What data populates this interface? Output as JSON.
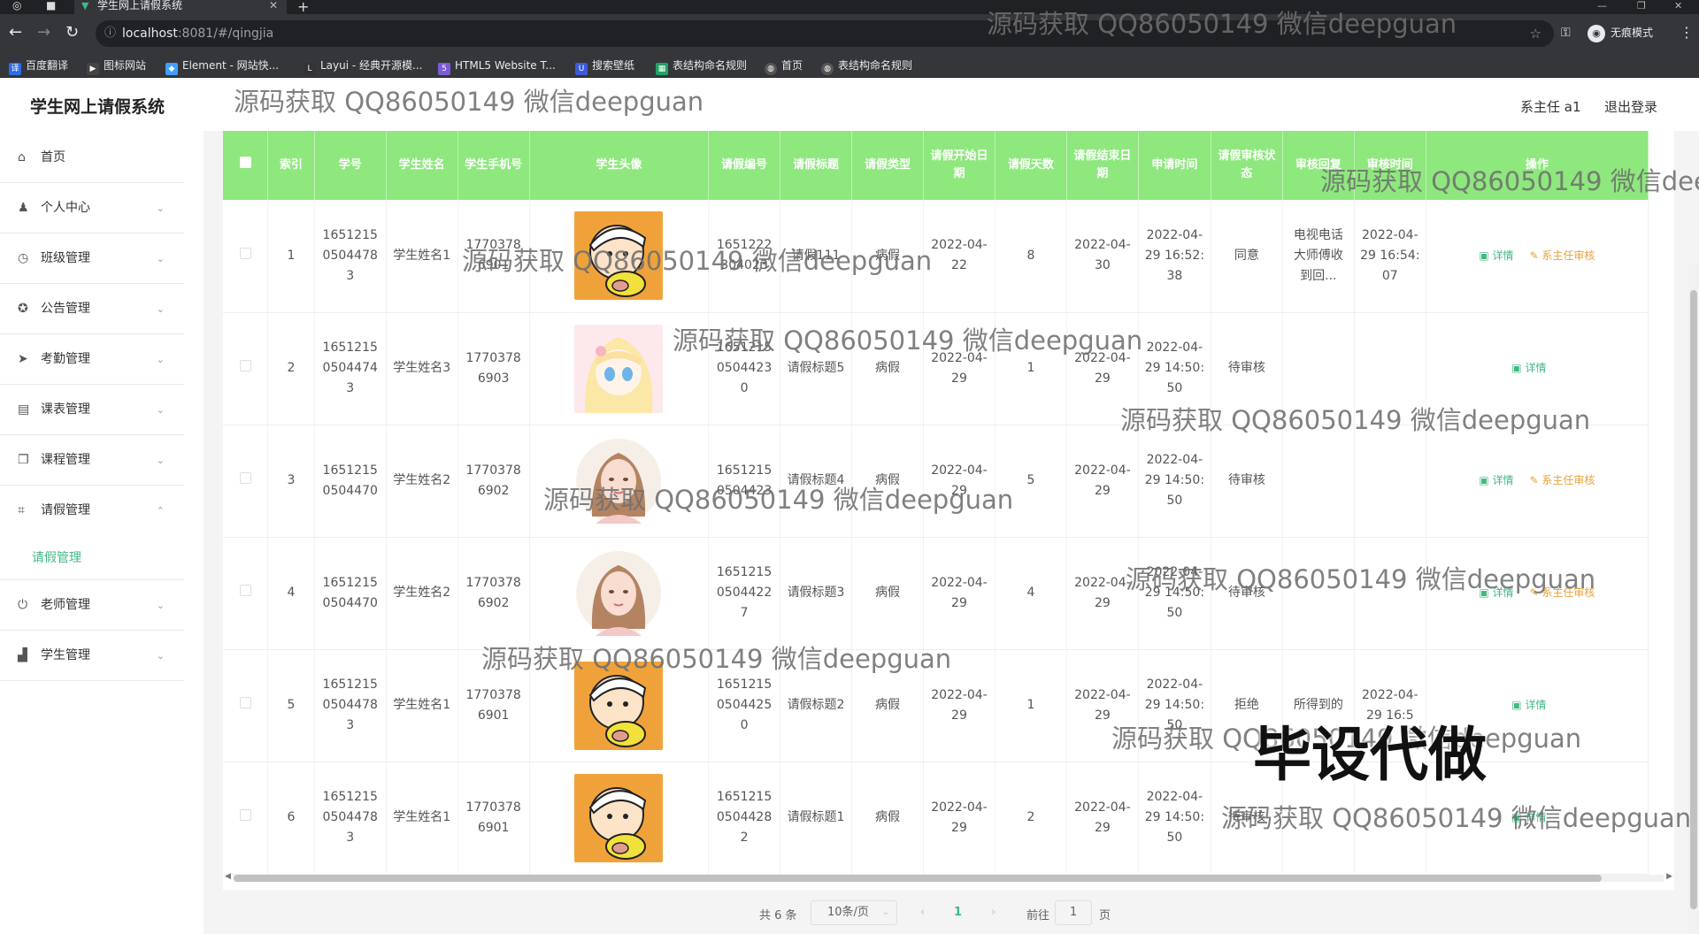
{
  "browser": {
    "tab_title": "学生网上请假系统",
    "url_host": "localhost",
    "url_path": ":8081/#/qingjia",
    "incognito_label": "无痕模式",
    "bookmarks": [
      "百度翻译",
      "图标网站",
      "Element - 网站快...",
      "Layui - 经典开源模...",
      "HTML5 Website T...",
      "搜索壁纸",
      "表结构命名规则",
      "首页",
      "表结构命名规则"
    ]
  },
  "app": {
    "title": "学生网上请假系统",
    "user_label": "系主任 a1",
    "logout_label": "退出登录"
  },
  "sidebar": {
    "items": [
      {
        "label": "首页",
        "icon": "home-icon"
      },
      {
        "label": "个人中心",
        "icon": "user-icon"
      },
      {
        "label": "班级管理",
        "icon": "clock-icon"
      },
      {
        "label": "公告管理",
        "icon": "compass-icon"
      },
      {
        "label": "考勤管理",
        "icon": "send-icon"
      },
      {
        "label": "课表管理",
        "icon": "briefcase-icon"
      },
      {
        "label": "课程管理",
        "icon": "copy-icon"
      },
      {
        "label": "请假管理",
        "icon": "crop-icon",
        "expanded": true
      },
      {
        "label": "老师管理",
        "icon": "power-icon"
      },
      {
        "label": "学生管理",
        "icon": "chart-icon"
      }
    ],
    "sub_item": "请假管理"
  },
  "table": {
    "headers": [
      "索引",
      "学号",
      "学生姓名",
      "学生手机号",
      "学生头像",
      "请假编号",
      "请假标题",
      "请假类型",
      "请假开始日期",
      "请假天数",
      "请假结束日期",
      "申请时间",
      "请假审核状态",
      "审核回复",
      "审核时间",
      "操作"
    ],
    "detail_label": "详情",
    "review_label": "系主任审核",
    "rows": [
      {
        "index": "1",
        "xuehao": "16512150504478 3",
        "name": "学生姓名1",
        "phone": "17703786901",
        "avatar": "crayon",
        "qjbh": "1651222304023",
        "title": "请假111",
        "type": "病假",
        "start": "2022-04-22",
        "days": "8",
        "end": "2022-04-30",
        "apply_time": "2022-04-29 16:52:38",
        "status": "同意",
        "reply": "电视电话大师傅收到回...",
        "review_time": "2022-04-29 16:54:07",
        "review_btn": true
      },
      {
        "index": "2",
        "xuehao": "16512150504474 3",
        "name": "学生姓名3",
        "phone": "17703786903",
        "avatar": "anime",
        "qjbh": "16512150504423 0",
        "title": "请假标题5",
        "type": "病假",
        "start": "2022-04-29",
        "days": "1",
        "end": "2022-04-29",
        "apply_time": "2022-04-29 14:50:50",
        "status": "待审核",
        "reply": "",
        "review_time": "",
        "review_btn": false
      },
      {
        "index": "3",
        "xuehao": "16512150504470",
        "name": "学生姓名2",
        "phone": "17703786902",
        "avatar": "girl",
        "qjbh": "16512150504423",
        "title": "请假标题4",
        "type": "病假",
        "start": "2022-04-29",
        "days": "5",
        "end": "2022-04-29",
        "apply_time": "2022-04-29 14:50:50",
        "status": "待审核",
        "reply": "",
        "review_time": "",
        "review_btn": true
      },
      {
        "index": "4",
        "xuehao": "16512150504470",
        "name": "学生姓名2",
        "phone": "17703786902",
        "avatar": "girl",
        "qjbh": "16512150504422 7",
        "title": "请假标题3",
        "type": "病假",
        "start": "2022-04-29",
        "days": "4",
        "end": "2022-04-29",
        "apply_time": "2022-04-29 14:50:50",
        "status": "待审核",
        "reply": "",
        "review_time": "",
        "review_btn": true
      },
      {
        "index": "5",
        "xuehao": "16512150504478 3",
        "name": "学生姓名1",
        "phone": "17703786901",
        "avatar": "crayon",
        "qjbh": "16512150504425 0",
        "title": "请假标题2",
        "type": "病假",
        "start": "2022-04-29",
        "days": "1",
        "end": "2022-04-29",
        "apply_time": "2022-04-29 14:50:50",
        "status": "拒绝",
        "reply": "所得到的",
        "review_time": "2022-04-29 16:5",
        "review_btn": false
      },
      {
        "index": "6",
        "xuehao": "16512150504478 3",
        "name": "学生姓名1",
        "phone": "17703786901",
        "avatar": "crayon",
        "qjbh": "16512150504428 2",
        "title": "请假标题1",
        "type": "病假",
        "start": "2022-04-29",
        "days": "2",
        "end": "2022-04-29",
        "apply_time": "2022-04-29 14:50:50",
        "status": "待审核",
        "reply": "",
        "review_time": "",
        "review_btn": false
      }
    ]
  },
  "pagination": {
    "total": "共 6 条",
    "page_size": "10条/页",
    "current": "1",
    "goto_label": "前往",
    "goto_value": "1",
    "page_suffix": "页"
  },
  "watermark": {
    "text": "源码获取 QQ86050149 微信deepguan",
    "banner": "毕设代做"
  },
  "colors": {
    "header_green": "#8ee87e",
    "accent": "#41b883",
    "warning": "#e6a23c"
  }
}
